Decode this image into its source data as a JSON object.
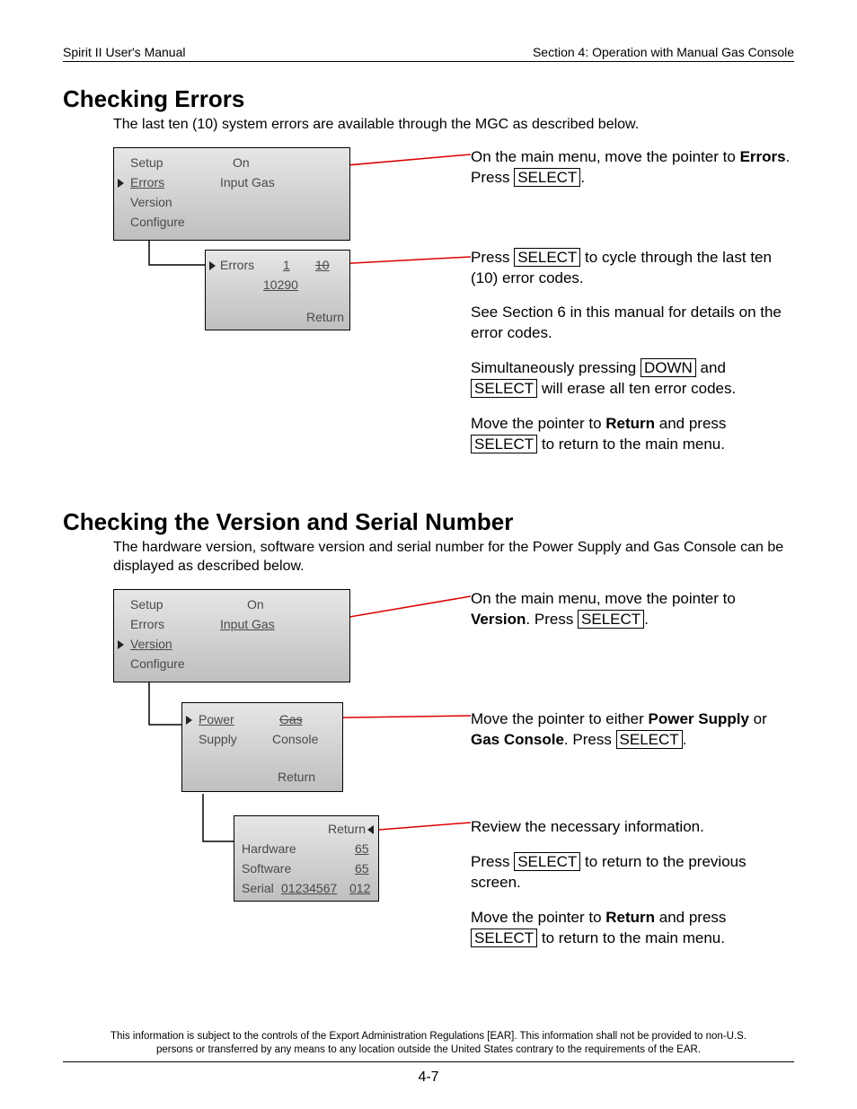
{
  "header": {
    "left": "Spirit II User's Manual",
    "right": "Section 4: Operation with Manual Gas Console"
  },
  "sectionA": {
    "title": "Checking Errors",
    "intro": "The last ten (10) system errors are available through the MGC as described below.",
    "lcd1": {
      "setup": "Setup",
      "on": "On",
      "errors": "Errors",
      "inputgas": "Input Gas",
      "version": "Version",
      "configure": "Configure"
    },
    "lcd2": {
      "errors": "Errors",
      "one": "1",
      "ten": "10",
      "code": "10290",
      "return": "Return"
    },
    "r1a": "On the main menu, move the pointer to ",
    "r1b": "Errors",
    "r1c": ". Press ",
    "select": "SELECT",
    "r1d": ".",
    "r2a": "Press ",
    "r2b": " to cycle through the last ten (10) error codes.",
    "r3": "See Section 6 in this manual for details on the error codes.",
    "r4a": "Simultaneously pressing ",
    "down": "DOWN",
    "r4b": " and ",
    "r4c": " will erase all ten error codes.",
    "r5a": "Move the pointer to ",
    "return": "Return",
    "r5b": " and press ",
    "r5c": " to return to the main menu."
  },
  "sectionB": {
    "title": "Checking the Version and Serial Number",
    "intro": "The hardware version, software version and serial number for the Power Supply and Gas Console can be displayed as described below.",
    "lcd1": {
      "setup": "Setup",
      "on": "On",
      "errors": "Errors",
      "inputgas": "Input Gas",
      "version": "Version",
      "configure": "Configure"
    },
    "lcd2": {
      "power": "Power",
      "supply": "Supply",
      "gas": "Gas",
      "console": "Console",
      "return": "Return"
    },
    "lcd3": {
      "return": "Return",
      "hardware": "Hardware",
      "hwv": "65",
      "software": "Software",
      "swv": "65",
      "serial": "Serial",
      "sn1": "01234567",
      "sn2": "012"
    },
    "r1a": "On the main menu, move the pointer to ",
    "r1b": "Version",
    "r1c": ".  Press ",
    "r1d": ".",
    "r2a": "Move the pointer to either ",
    "r2b": "Power Supply",
    "r2c": " or ",
    "r2d": "Gas Console",
    "r2e": ".  Press ",
    "r2f": ".",
    "r3": "Review the necessary information.",
    "r4a": "Press ",
    "r4b": " to return to the previous screen.",
    "r5a": "Move the pointer to ",
    "r5b": " and press ",
    "r5c": " to return to the main menu."
  },
  "footer": {
    "disclaimer": "This information is subject to the controls of the Export Administration Regulations [EAR].  This information shall not be provided to non-U.S. persons or transferred by any means to any location outside the United States contrary to the requirements of the EAR.",
    "pagenum": "4-7"
  }
}
